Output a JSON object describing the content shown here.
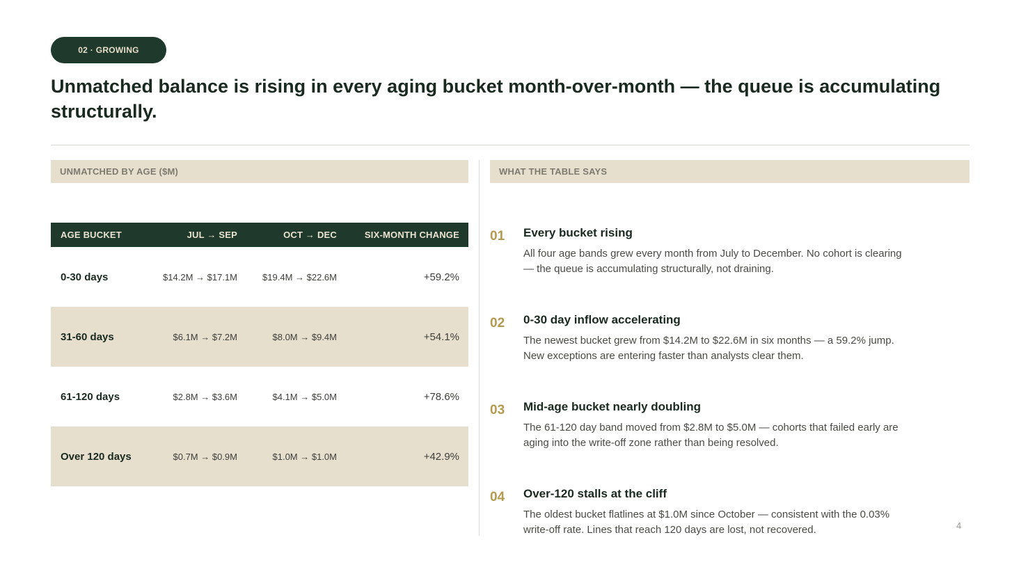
{
  "badge": "02 · GROWING",
  "title": "Unmatched balance is rising in every aging bucket month-over-month — the queue is accumulating structurally.",
  "left_panel": {
    "heading": "UNMATCHED BY AGE ($M)"
  },
  "right_panel": {
    "heading": "WHAT THE TABLE SAYS"
  },
  "table": {
    "headers": [
      "AGE BUCKET",
      "JUL → SEP",
      "OCT → DEC",
      "SIX-MONTH CHANGE"
    ],
    "rows": [
      {
        "bucket": "0-30 days",
        "jul_sep": "$14.2M → $17.1M",
        "oct_dec": "$19.4M → $22.6M",
        "change": "+59.2%"
      },
      {
        "bucket": "31-60 days",
        "jul_sep": "$6.1M → $7.2M",
        "oct_dec": "$8.0M → $9.4M",
        "change": "+54.1%"
      },
      {
        "bucket": "61-120 days",
        "jul_sep": "$2.8M → $3.6M",
        "oct_dec": "$4.1M → $5.0M",
        "change": "+78.6%"
      },
      {
        "bucket": "Over 120 days",
        "jul_sep": "$0.7M → $0.9M",
        "oct_dec": "$1.0M → $1.0M",
        "change": "+42.9%"
      }
    ]
  },
  "findings": [
    {
      "num": "01",
      "title": "Every bucket rising",
      "body": "All four age bands grew every month from July to December. No cohort is clearing — the queue is accumulating structurally, not draining."
    },
    {
      "num": "02",
      "title": "0-30 day inflow accelerating",
      "body": "The newest bucket grew from $14.2M to $22.6M in six months — a 59.2% jump. New exceptions are entering faster than analysts clear them."
    },
    {
      "num": "03",
      "title": "Mid-age bucket nearly doubling",
      "body": "The 61-120 day band moved from $2.8M to $5.0M — cohorts that failed early are aging into the write-off zone rather than being resolved."
    },
    {
      "num": "04",
      "title": "Over-120 stalls at the cliff",
      "body": "The oldest bucket flatlines at $1.0M since October — consistent with the 0.03% write-off rate. Lines that reach 120 days are lost, not recovered."
    }
  ],
  "page_number": "4"
}
